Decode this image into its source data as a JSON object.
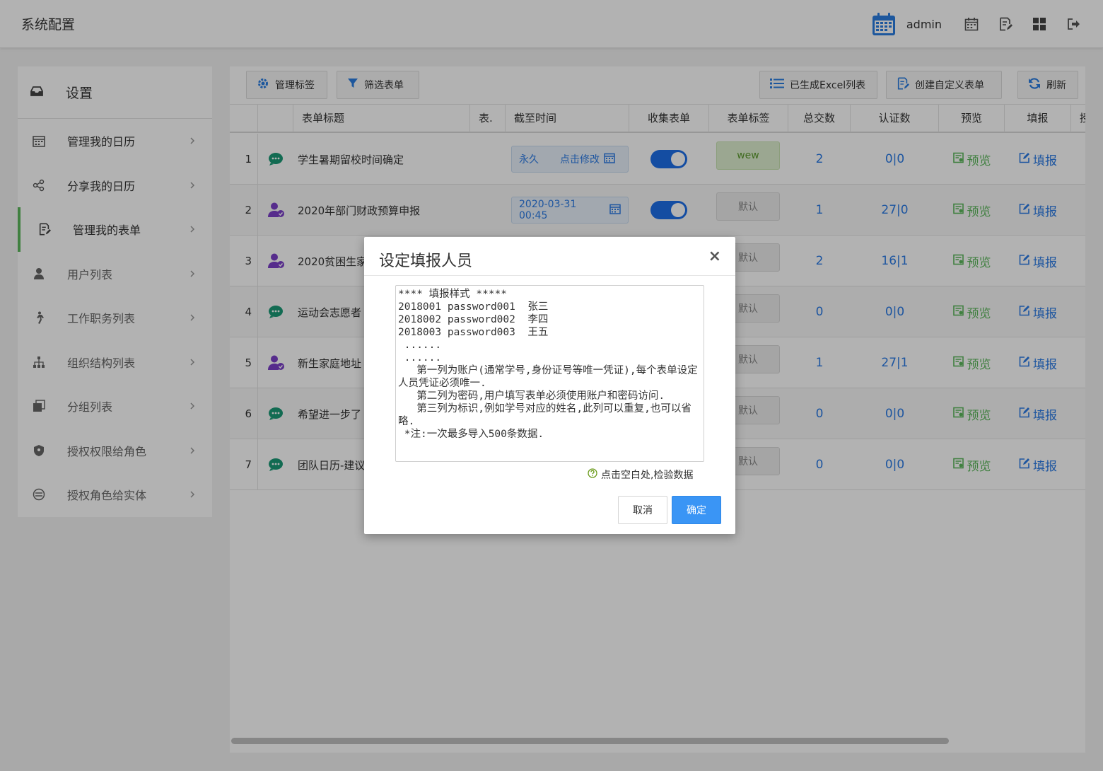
{
  "app": {
    "title": "系统配置"
  },
  "topbar": {
    "user": "admin"
  },
  "sidebar": {
    "header": "设置",
    "items": [
      {
        "label": "管理我的日历",
        "icon": "calendar-icon"
      },
      {
        "label": "分享我的日历",
        "icon": "share-icon"
      },
      {
        "label": "管理我的表单",
        "icon": "form-edit-icon"
      },
      {
        "label": "用户列表",
        "icon": "user-icon"
      },
      {
        "label": "工作职务列表",
        "icon": "walking-person-icon"
      },
      {
        "label": "组织结构列表",
        "icon": "sitemap-icon"
      },
      {
        "label": "分组列表",
        "icon": "group-icon"
      },
      {
        "label": "授权权限给角色",
        "icon": "shield-icon"
      },
      {
        "label": "授权角色给实体",
        "icon": "role-entity-icon"
      }
    ],
    "active_index": 2
  },
  "toolbar": {
    "manage_tags": "管理标签",
    "filter_forms": "筛选表单",
    "excel_list": "已生成Excel列表",
    "create_form": "创建自定义表单",
    "refresh": "刷新"
  },
  "table": {
    "headers": {
      "title": "表单标题",
      "type": "表.",
      "deadline": "截至时间",
      "collect": "收集表单",
      "tag": "表单标签",
      "total": "总交数",
      "verified": "认证数",
      "preview": "预览",
      "fill": "填报",
      "more": "授"
    },
    "rows": [
      {
        "idx": "1",
        "title": "学生暑期留校时间确定",
        "date_left": "永久",
        "date_right": "点击修改",
        "tag": "wew",
        "total": "2",
        "verified": "0|0",
        "preview": "预览",
        "fill": "填报"
      },
      {
        "idx": "2",
        "title": "2020年部门财政预算申报",
        "date_left": "2020-03-31 00:45",
        "date_right": "",
        "tag": "默认",
        "total": "1",
        "verified": "27|0",
        "preview": "预览",
        "fill": "填报"
      },
      {
        "idx": "3",
        "title": "2020贫困生家",
        "tag": "默认",
        "total": "2",
        "verified": "16|1",
        "preview": "预览",
        "fill": "填报"
      },
      {
        "idx": "4",
        "title": "运动会志愿者",
        "tag": "默认",
        "total": "0",
        "verified": "0|0",
        "preview": "预览",
        "fill": "填报"
      },
      {
        "idx": "5",
        "title": "新生家庭地址",
        "tag": "默认",
        "total": "1",
        "verified": "27|1",
        "preview": "预览",
        "fill": "填报"
      },
      {
        "idx": "6",
        "title": "希望进一步了",
        "tag": "默认",
        "total": "0",
        "verified": "0|0",
        "preview": "预览",
        "fill": "填报"
      },
      {
        "idx": "7",
        "title": "团队日历-建议",
        "tag": "默认",
        "total": "0",
        "verified": "0|0",
        "preview": "预览",
        "fill": "填报"
      }
    ]
  },
  "modal": {
    "title": "设定填报人员",
    "close": "×",
    "text": "**** 填报样式 *****\n2018001 password001  张三\n2018002 password002  李四\n2018003 password003  王五\n ......\n ......\n   第一列为账户(通常学号,身份证号等唯一凭证),每个表单设定人员凭证必须唯一.\n   第二列为密码,用户填写表单必须使用账户和密码访问.\n   第三列为标识,例如学号对应的姓名,此列可以重复,也可以省略.\n *注:一次最多导入500条数据.",
    "hint": "点击空白处,检验数据",
    "cancel": "取消",
    "ok": "确定"
  },
  "colors": {
    "accent": "#3a95f5",
    "active_bar": "#5cb85c",
    "link": "#2c7be5",
    "preview": "#5cb85c"
  }
}
